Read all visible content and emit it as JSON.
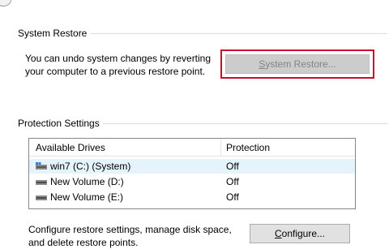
{
  "system_restore": {
    "group_title": "System Restore",
    "description_line1": "You can undo system changes by reverting",
    "description_line2": "your computer to a previous restore point.",
    "button_label_prefix": "S",
    "button_label_rest": "ystem Restore..."
  },
  "protection": {
    "group_title": "Protection Settings",
    "columns": [
      "Available Drives",
      "Protection"
    ],
    "drives": [
      {
        "name": "win7 (C:) (System)",
        "protection": "Off",
        "icon": "system-drive-icon"
      },
      {
        "name": "New Volume (D:)",
        "protection": "Off",
        "icon": "hard-drive-icon"
      },
      {
        "name": "New Volume (E:)",
        "protection": "Off",
        "icon": "hard-drive-icon"
      }
    ],
    "configure_line1": "Configure restore settings, manage disk space,",
    "configure_line2": "and delete restore points.",
    "configure_prefix": "C",
    "configure_rest": "onfigure..."
  },
  "colors": {
    "highlight": "#c8102e",
    "selected_row": "#e5f3fb"
  }
}
